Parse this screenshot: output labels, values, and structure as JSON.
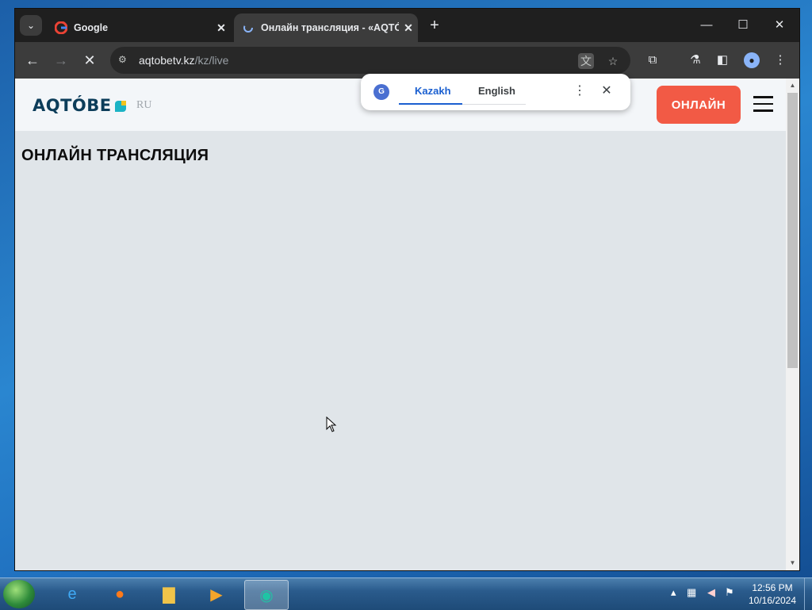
{
  "browser": {
    "tabs": [
      {
        "title": "Google",
        "active": false
      },
      {
        "title": "Онлайн трансляция - «AQTÓBE»",
        "active": true
      }
    ],
    "url": {
      "domain": "aqtobetv.kz",
      "path": "/kz/live"
    }
  },
  "translate_popup": {
    "languages": [
      "Kazakh",
      "English"
    ],
    "selected": "Kazakh"
  },
  "site": {
    "logo": "AQTÓBE",
    "lang_switch": "RU",
    "live_button": "ОНЛАЙН",
    "page_title": "ОНЛАЙН ТРАНСЛЯЦИЯ"
  },
  "taskbar": {
    "time": "12:56 PM",
    "date": "10/16/2024"
  },
  "colors": {
    "accent_live": "#f25a45",
    "page_bg": "#e0e5e9",
    "logo_text": "#0c3d5a"
  }
}
